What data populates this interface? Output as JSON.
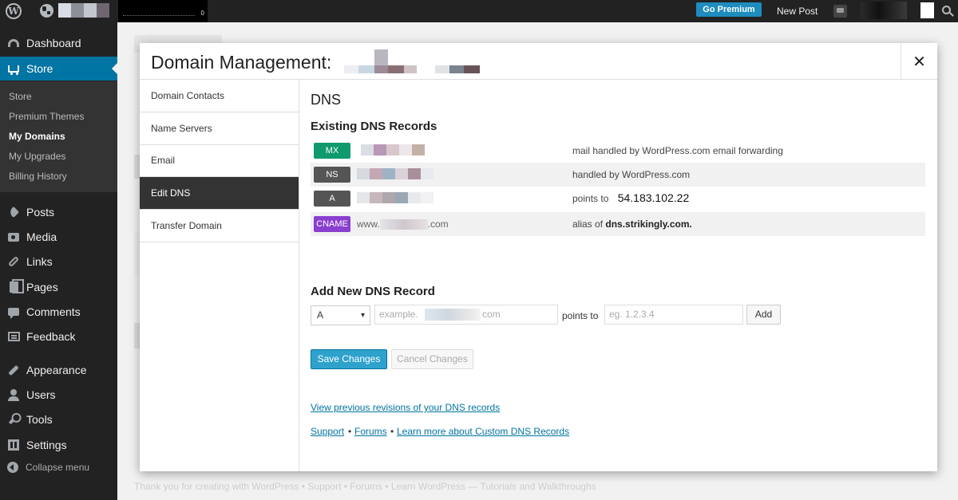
{
  "admin_bar": {
    "stats_count": "0",
    "go_premium": "Go Premium",
    "new_post": "New Post"
  },
  "sidebar": {
    "menu": [
      {
        "label": "Dashboard",
        "icon": "dashboard-icon"
      },
      {
        "label": "Store",
        "icon": "cart-icon",
        "active": true
      },
      {
        "label": "Posts",
        "icon": "pin-icon"
      },
      {
        "label": "Media",
        "icon": "media-icon"
      },
      {
        "label": "Links",
        "icon": "link-icon"
      },
      {
        "label": "Pages",
        "icon": "pages-icon"
      },
      {
        "label": "Comments",
        "icon": "comment-icon"
      },
      {
        "label": "Feedback",
        "icon": "feedback-icon"
      },
      {
        "label": "Appearance",
        "icon": "brush-icon"
      },
      {
        "label": "Users",
        "icon": "user-icon"
      },
      {
        "label": "Tools",
        "icon": "wrench-icon"
      },
      {
        "label": "Settings",
        "icon": "settings-icon"
      }
    ],
    "store_submenu": [
      "Store",
      "Premium Themes",
      "My Domains",
      "My Upgrades",
      "Billing History"
    ],
    "current_submenu": "My Domains",
    "collapse_label": "Collapse menu"
  },
  "background_page": {
    "footer": "Thank you for creating with WordPress • Support • Forums • Learn WordPress — Tutorials and Walkthroughs"
  },
  "modal": {
    "title": "Domain Management:",
    "close_symbol": "✕",
    "nav": [
      "Domain Contacts",
      "Name Servers",
      "Email",
      "Edit DNS",
      "Transfer Domain"
    ],
    "selected_nav": "Edit DNS",
    "dns": {
      "heading": "DNS",
      "existing_heading": "Existing DNS Records",
      "records": [
        {
          "type": "MX",
          "name": "",
          "value_text": "mail handled by WordPress.com email forwarding",
          "color": "#0e9a6e"
        },
        {
          "type": "NS",
          "name": "",
          "value_text": "handled by WordPress.com",
          "color": "#555555"
        },
        {
          "type": "A",
          "name": "",
          "value_prefix": "points to",
          "value_strong": "54.183.102.22",
          "color": "#555555"
        },
        {
          "type": "CNAME",
          "name_prefix": "www.",
          "name_suffix": ".com",
          "value_prefix": "alias of",
          "value_strong": "dns.strikingly.com.",
          "color": "#8a3fcf"
        }
      ],
      "add_heading": "Add New DNS Record",
      "type_select": "A",
      "name_placeholder_prefix": "example.",
      "name_placeholder_suffix": "com",
      "points_to_label": "points to",
      "value_placeholder": "eg. 1.2.3.4",
      "add_button": "Add",
      "save_button": "Save Changes",
      "cancel_button": "Cancel Changes",
      "revisions_link": "View previous revisions of your DNS records",
      "footer_links": [
        "Support",
        "Forums",
        "Learn more about Custom DNS Records"
      ],
      "separator": "•"
    }
  }
}
